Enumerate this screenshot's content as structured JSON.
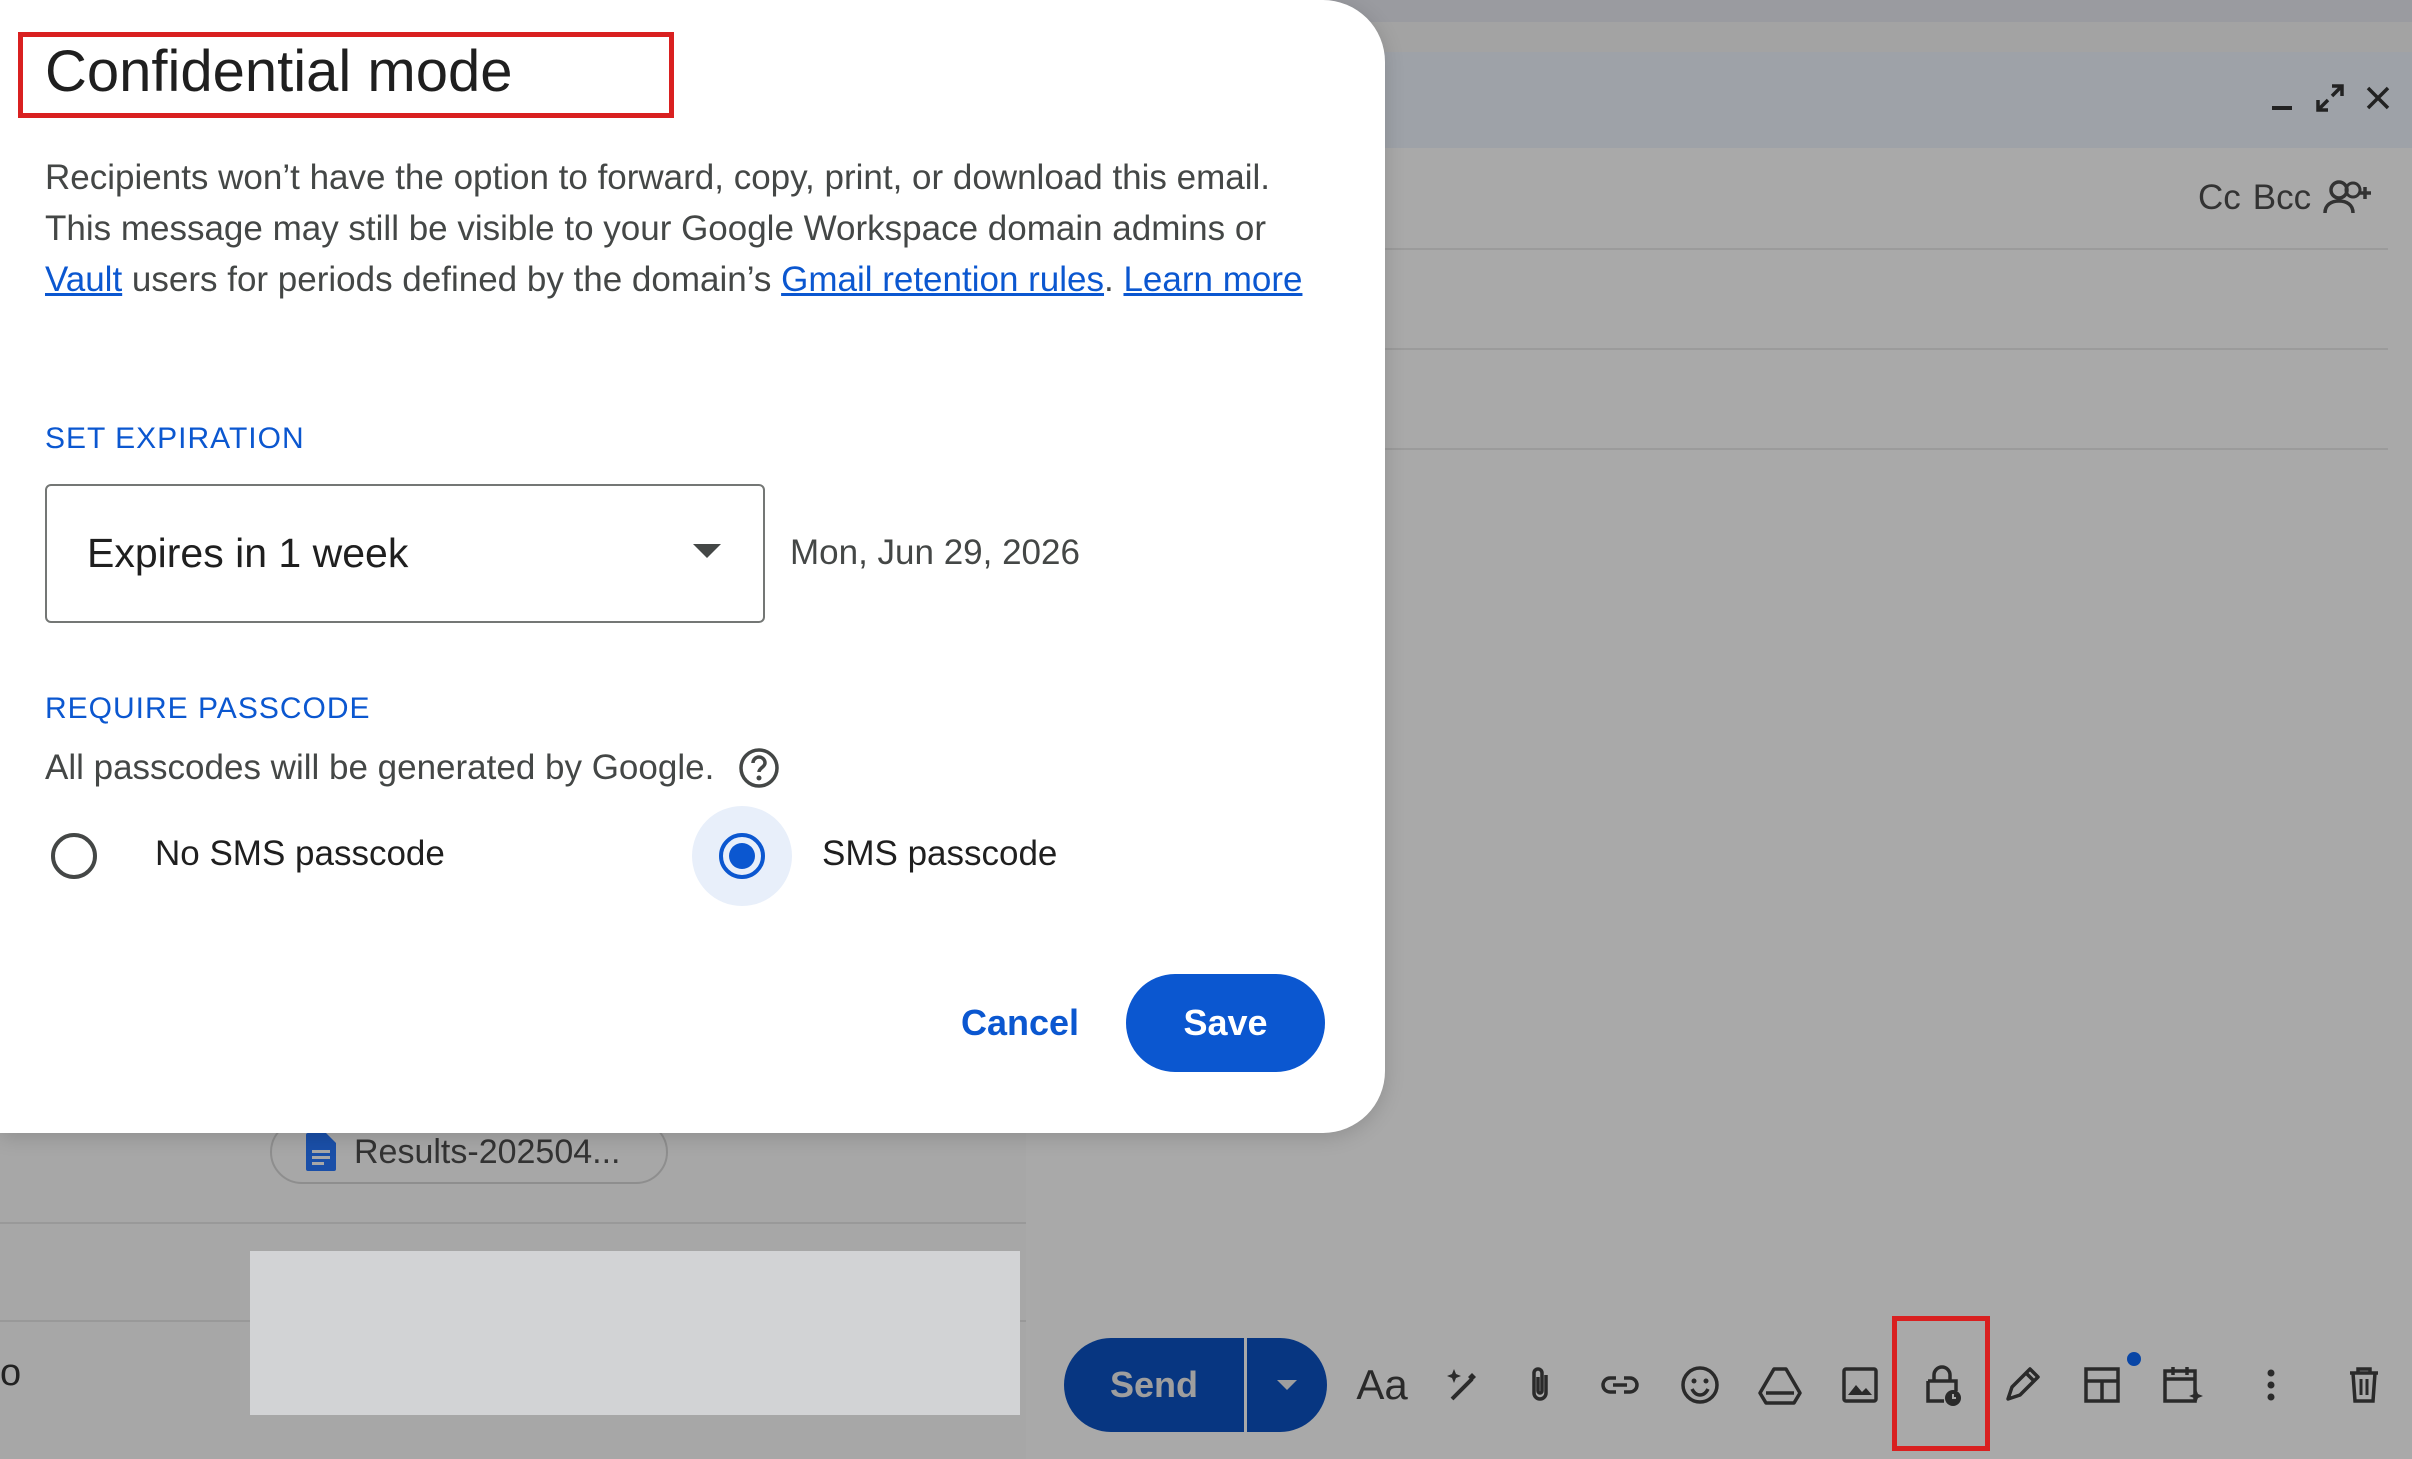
{
  "dialog": {
    "title": "Confidential mode",
    "description_part1": "Recipients won’t have the option to forward, copy, print, or download this email. This message may still be visible to your Google Workspace domain admins or ",
    "link_vault": "Vault",
    "description_part2": " users for periods defined by the domain’s ",
    "link_retention": "Gmail retention rules",
    "description_part3": ". ",
    "link_learn_more": "Learn more",
    "set_expiration_label": "SET EXPIRATION",
    "expiration_value": "Expires in 1 week",
    "expiration_date": "Mon, Jun 29, 2026",
    "require_passcode_label": "REQUIRE PASSCODE",
    "passcode_note": "All passcodes will be generated by Google.",
    "radio_no_sms": "No SMS passcode",
    "radio_sms": "SMS passcode",
    "selected_option": "SMS passcode",
    "cancel_label": "Cancel",
    "save_label": "Save"
  },
  "compose": {
    "cc_label": "Cc",
    "bcc_label": "Bcc",
    "send_label": "Send",
    "format_label": "Aa",
    "toolbar_icons": [
      "format-text-icon",
      "ai-write-icon",
      "attach-icon",
      "link-icon",
      "emoji-icon",
      "drive-icon",
      "photo-icon",
      "confidential-lock-icon",
      "signature-pen-icon",
      "layout-icon",
      "schedule-icon",
      "more-icon",
      "trash-icon"
    ]
  },
  "background": {
    "attachment_name": "Results-202504...",
    "cut_char": "o"
  },
  "colors": {
    "accent": "#0b57d0",
    "highlight_red": "#d92020"
  }
}
